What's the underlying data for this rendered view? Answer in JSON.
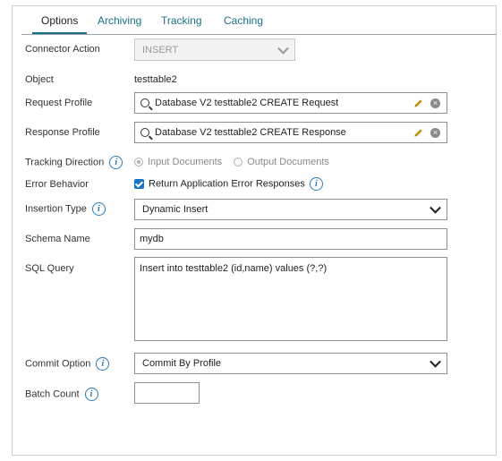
{
  "tabs": [
    {
      "label": "Options"
    },
    {
      "label": "Archiving"
    },
    {
      "label": "Tracking"
    },
    {
      "label": "Caching"
    }
  ],
  "connector_action": {
    "label": "Connector Action",
    "value": "INSERT"
  },
  "object": {
    "label": "Object",
    "value": "testtable2"
  },
  "request_profile": {
    "label": "Request Profile",
    "value": "Database V2 testtable2 CREATE Request"
  },
  "response_profile": {
    "label": "Response Profile",
    "value": "Database V2 testtable2 CREATE Response"
  },
  "tracking_direction": {
    "label": "Tracking Direction",
    "options": [
      "Input Documents",
      "Output Documents"
    ],
    "selected": "Input Documents"
  },
  "error_behavior": {
    "label": "Error Behavior",
    "checkbox_label": "Return Application Error Responses",
    "checked": true
  },
  "insertion_type": {
    "label": "Insertion Type",
    "value": "Dynamic Insert"
  },
  "schema_name": {
    "label": "Schema Name",
    "value": "mydb"
  },
  "sql_query": {
    "label": "SQL Query",
    "value": "Insert into testtable2 (id,name) values (?,?)"
  },
  "commit_option": {
    "label": "Commit Option",
    "value": "Commit By Profile"
  },
  "batch_count": {
    "label": "Batch Count",
    "value": ""
  },
  "info_glyph": "i",
  "clear_glyph": "×",
  "colors": {
    "accent": "#1d6f8a",
    "info": "#2a7ab8",
    "checkbox": "#1a73c9",
    "pencil": "#e0a400"
  }
}
